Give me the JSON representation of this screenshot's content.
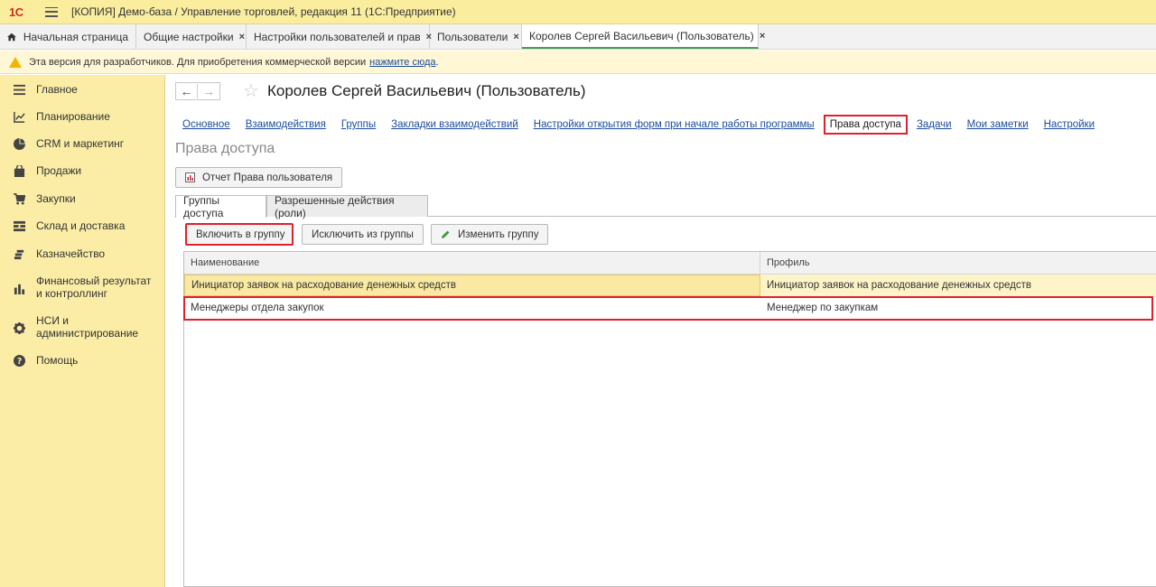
{
  "window": {
    "title": "[КОПИЯ] Демо-база / Управление торговлей, редакция 11  (1С:Предприятие)",
    "logo_text": "1С"
  },
  "tabs": [
    {
      "label": "Начальная страница",
      "closable": false
    },
    {
      "label": "Общие настройки",
      "closable": true
    },
    {
      "label": "Настройки пользователей и прав",
      "closable": true
    },
    {
      "label": "Пользователи",
      "closable": true
    },
    {
      "label": "Королев Сергей Васильевич (Пользователь)",
      "closable": true
    }
  ],
  "close_glyph": "×",
  "warning": {
    "text": "Эта версия для разработчиков. Для приобретения коммерческой версии",
    "link": "нажмите сюда",
    "suffix": "."
  },
  "sidebar": {
    "items": [
      {
        "label": "Главное",
        "icon": "list-icon"
      },
      {
        "label": "Планирование",
        "icon": "chart-trend-icon"
      },
      {
        "label": "CRM и маркетинг",
        "icon": "pie-icon"
      },
      {
        "label": "Продажи",
        "icon": "bag-icon"
      },
      {
        "label": "Закупки",
        "icon": "cart-icon"
      },
      {
        "label": "Склад и доставка",
        "icon": "warehouse-icon"
      },
      {
        "label": "Казначейство",
        "icon": "coins-icon"
      },
      {
        "label": "Финансовый результат и контроллинг",
        "icon": "bar-chart-icon"
      },
      {
        "label": "НСИ и администрирование",
        "icon": "gear-icon"
      },
      {
        "label": "Помощь",
        "icon": "help-icon"
      }
    ]
  },
  "header": {
    "back": "←",
    "forward": "→",
    "star": "☆",
    "title": "Королев Сергей Васильевич (Пользователь)"
  },
  "section_links": [
    {
      "label": "Основное",
      "selected": false
    },
    {
      "label": "Взаимодействия",
      "selected": false
    },
    {
      "label": "Группы",
      "selected": false
    },
    {
      "label": "Закладки взаимодействий",
      "selected": false
    },
    {
      "label": "Настройки открытия форм при начале работы программы",
      "selected": false
    },
    {
      "label": "Права доступа",
      "selected": true
    },
    {
      "label": "Задачи",
      "selected": false
    },
    {
      "label": "Мои заметки",
      "selected": false
    },
    {
      "label": "Настройки",
      "selected": false
    }
  ],
  "section_title": "Права доступа",
  "report_button": "Отчет Права пользователя",
  "subtabs": [
    {
      "label": "Группы доступа",
      "active": true
    },
    {
      "label": "Разрешенные действия (роли)",
      "active": false
    }
  ],
  "actions": {
    "include": "Включить в группу",
    "exclude": "Исключить из группы",
    "edit": "Изменить группу"
  },
  "table": {
    "columns": [
      "Наименование",
      "Профиль"
    ],
    "rows": [
      [
        "Инициатор заявок на расходование денежных средств",
        "Инициатор заявок на расходование денежных средств"
      ],
      [
        "Менеджеры отдела закупок",
        "Менеджер по закупкам"
      ]
    ]
  },
  "colors": {
    "accent_red": "#e0202b",
    "sidebar_bg": "#fbeda5",
    "titlebar_bg": "#fbed9e",
    "link": "#1a4d9c",
    "active_tab_underline": "#49a047"
  }
}
